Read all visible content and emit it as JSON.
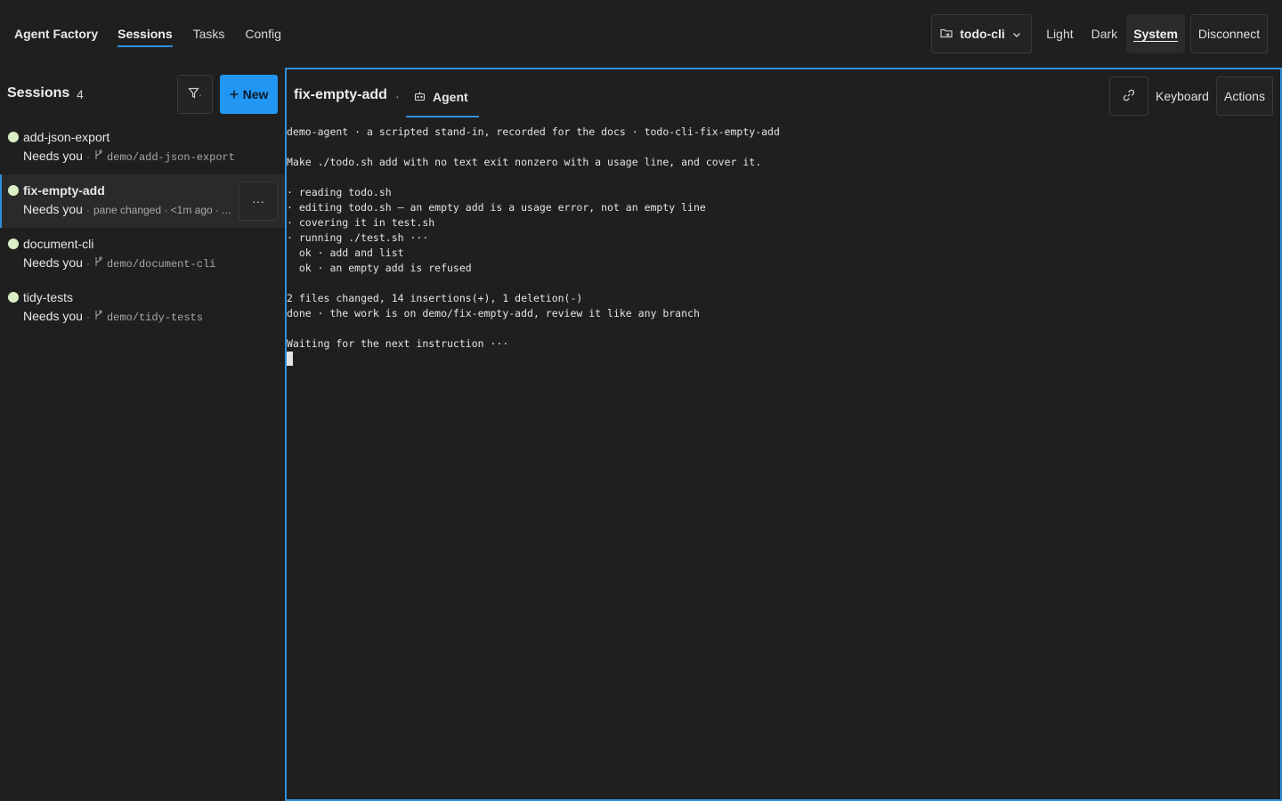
{
  "topbar": {
    "brand": "Agent Factory",
    "nav": [
      "Sessions",
      "Tasks",
      "Config"
    ],
    "active_nav": "Sessions",
    "project": "todo-cli",
    "themes": [
      "Light",
      "Dark",
      "System"
    ],
    "active_theme": "System",
    "disconnect_label": "Disconnect"
  },
  "sidebar": {
    "title": "Sessions",
    "count": "4",
    "new_label": "New",
    "sessions": [
      {
        "name": "add-json-export",
        "status": "Needs you",
        "branch": "demo/add-json-export"
      },
      {
        "name": "fix-empty-add",
        "status": "Needs you",
        "detail": "pane changed · <1m ago · ...",
        "more": "···"
      },
      {
        "name": "document-cli",
        "status": "Needs you",
        "branch": "demo/document-cli"
      },
      {
        "name": "tidy-tests",
        "status": "Needs you",
        "branch": "demo/tidy-tests"
      }
    ]
  },
  "pane": {
    "title": "fix-empty-add",
    "separator": "·",
    "tab_label": "Agent",
    "keyboard_label": "Keyboard",
    "actions_label": "Actions",
    "terminal": [
      "demo-agent · a scripted stand-in, recorded for the docs · todo-cli-fix-empty-add",
      "",
      "Make ./todo.sh add with no text exit nonzero with a usage line, and cover it.",
      "",
      "· reading todo.sh",
      "· editing todo.sh — an empty add is a usage error, not an empty line",
      "· covering it in test.sh",
      "· running ./test.sh ···",
      "  ok · add and list",
      "  ok · an empty add is refused",
      "",
      "2 files changed, 14 insertions(+), 1 deletion(-)",
      "done · the work is on demo/fix-empty-add, review it like any branch",
      "",
      "Waiting for the next instruction ···"
    ]
  }
}
